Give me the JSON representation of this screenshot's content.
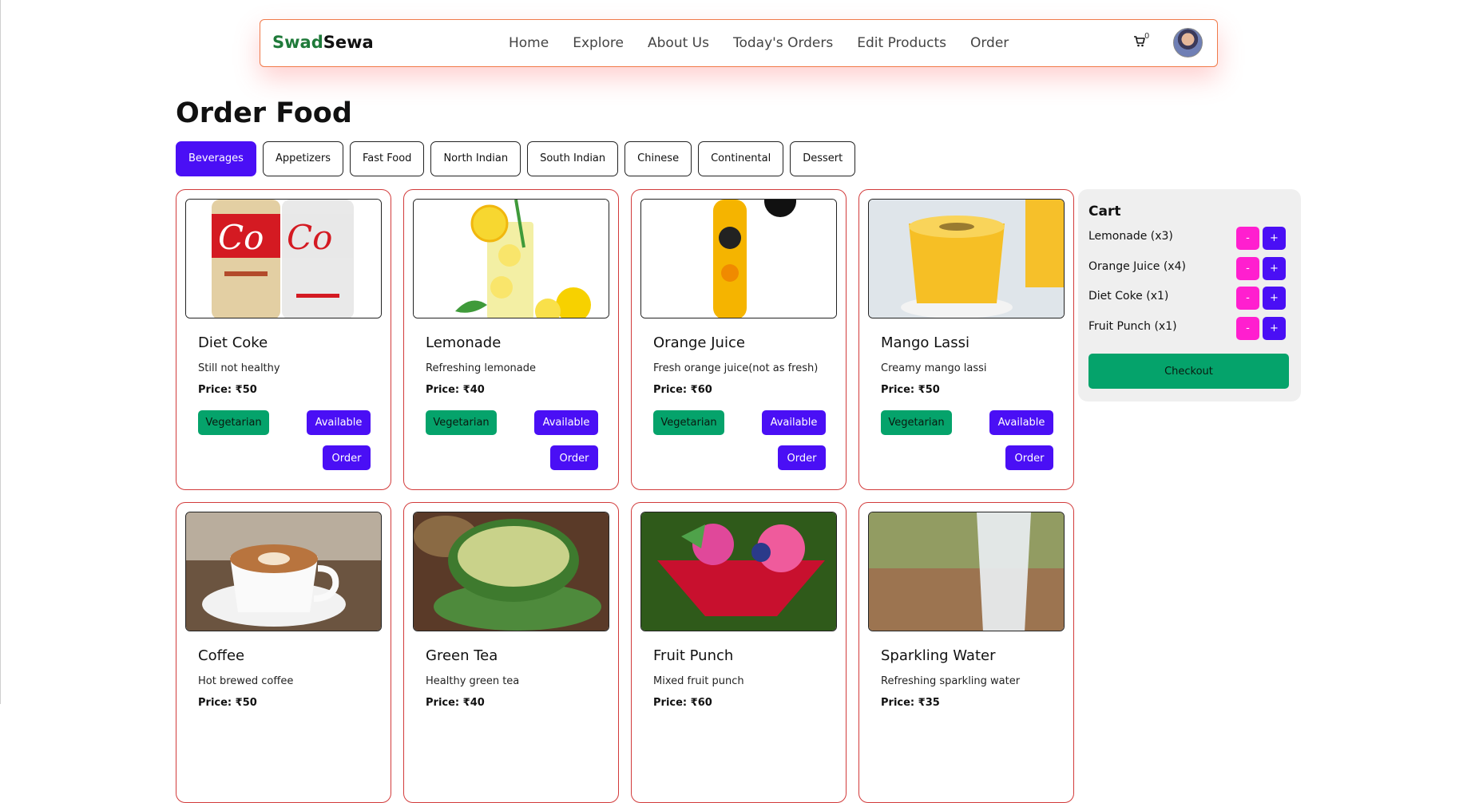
{
  "brand": {
    "part1": "Swad",
    "part2": "Sewa"
  },
  "nav": [
    "Home",
    "Explore",
    "About Us",
    "Today's Orders",
    "Edit Products",
    "Order"
  ],
  "cart_icon": "cart-icon",
  "cart_count": "0",
  "page_title": "Order Food",
  "tabs": [
    "Beverages",
    "Appetizers",
    "Fast Food",
    "North Indian",
    "South Indian",
    "Chinese",
    "Continental",
    "Dessert"
  ],
  "active_tab": "Beverages",
  "products": [
    {
      "name": "Diet Coke",
      "desc": "Still not healthy",
      "price": "Price: ₹50",
      "veg": "Vegetarian",
      "status": "Available",
      "order": "Order",
      "image": "soda-cans"
    },
    {
      "name": "Lemonade",
      "desc": "Refreshing lemonade",
      "price": "Price: ₹40",
      "veg": "Vegetarian",
      "status": "Available",
      "order": "Order",
      "image": "lemonade-glass"
    },
    {
      "name": "Orange Juice",
      "desc": "Fresh orange juice(not as fresh)",
      "price": "Price: ₹60",
      "veg": "Vegetarian",
      "status": "Available",
      "order": "Order",
      "image": "juice-bottle"
    },
    {
      "name": "Mango Lassi",
      "desc": "Creamy mango lassi",
      "price": "Price: ₹50",
      "veg": "Vegetarian",
      "status": "Available",
      "order": "Order",
      "image": "lassi-glass"
    },
    {
      "name": "Coffee",
      "desc": "Hot brewed coffee",
      "price": "Price: ₹50",
      "image": "coffee-cup"
    },
    {
      "name": "Green Tea",
      "desc": "Healthy green tea",
      "price": "Price: ₹40",
      "image": "tea-cup"
    },
    {
      "name": "Fruit Punch",
      "desc": "Mixed fruit punch",
      "price": "Price: ₹60",
      "image": "fruit-bowl"
    },
    {
      "name": "Sparkling Water",
      "desc": "Refreshing sparkling water",
      "price": "Price: ₹35",
      "image": "water-glass"
    }
  ],
  "cart": {
    "title": "Cart",
    "items": [
      "Lemonade (x3)",
      "Orange Juice (x4)",
      "Diet Coke (x1)",
      "Fruit Punch (x1)"
    ],
    "minus": "-",
    "plus": "+",
    "checkout": "Checkout"
  },
  "colors": {
    "brand_green": "#1f7a3a",
    "accent": "#4a0ff5",
    "veg_green": "#05a36b",
    "minus_pink": "#ff1fcf",
    "card_border": "#d23b3b"
  }
}
